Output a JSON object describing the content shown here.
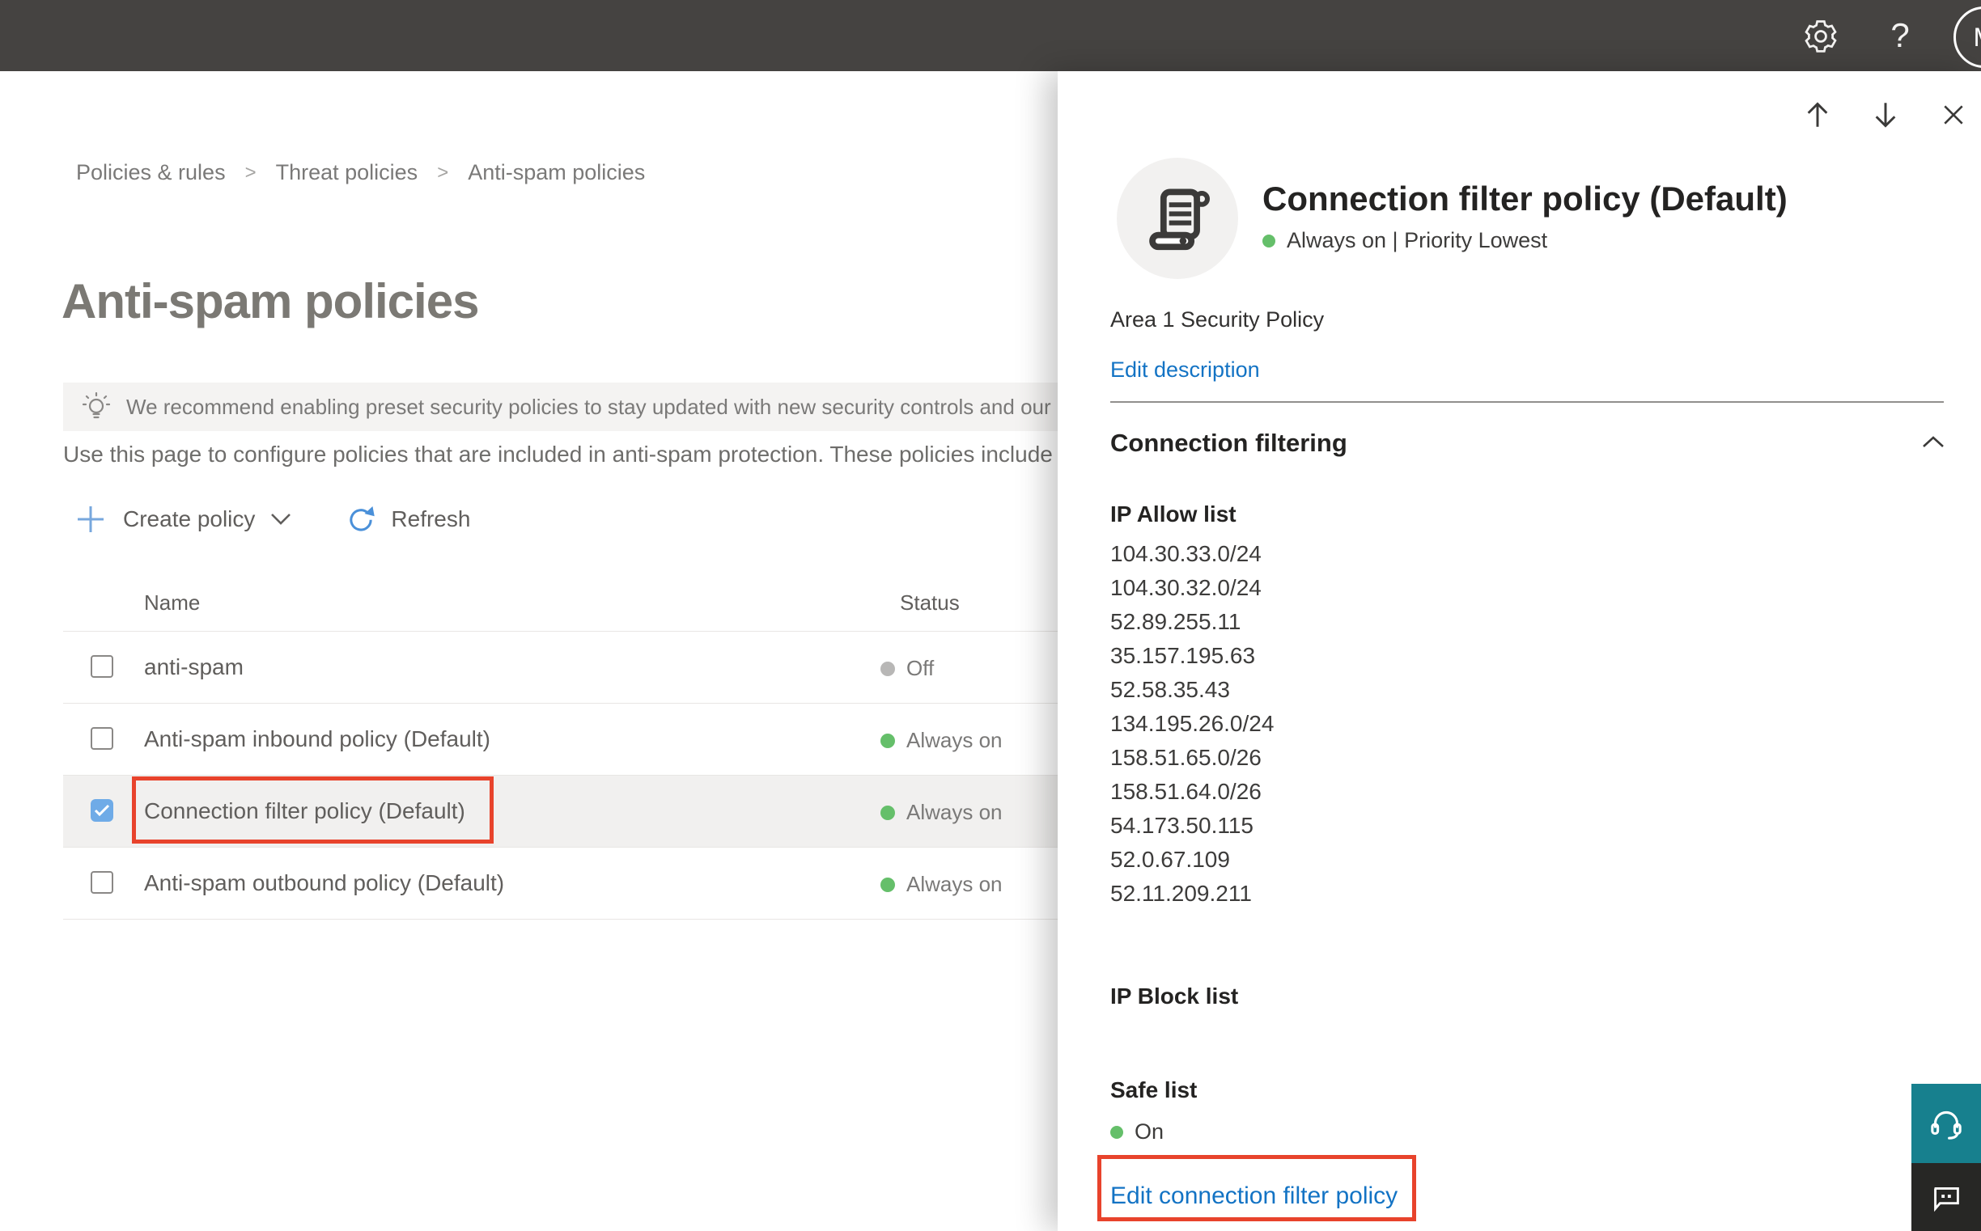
{
  "topbar": {
    "avatar_initial": "M"
  },
  "breadcrumb": {
    "separator": ">",
    "items": [
      "Policies & rules",
      "Threat policies",
      "Anti-spam policies"
    ]
  },
  "page": {
    "title": "Anti-spam policies",
    "banner_text": "We recommend enabling preset security policies to stay updated with new security controls and our recomme",
    "description": "Use this page to configure policies that are included in anti-spam protection. These policies include"
  },
  "toolbar": {
    "create_label": "Create policy",
    "refresh_label": "Refresh"
  },
  "table": {
    "headers": {
      "name": "Name",
      "status": "Status"
    },
    "rows": [
      {
        "name": "anti-spam",
        "status": "Off",
        "status_color": "#b8b7b6",
        "checked": false,
        "selected": false
      },
      {
        "name": "Anti-spam inbound policy (Default)",
        "status": "Always on",
        "status_color": "#65bf6a",
        "checked": false,
        "selected": false
      },
      {
        "name": "Connection filter policy (Default)",
        "status": "Always on",
        "status_color": "#65bf6a",
        "checked": true,
        "selected": true,
        "annotated": true
      },
      {
        "name": "Anti-spam outbound policy (Default)",
        "status": "Always on",
        "status_color": "#65bf6a",
        "checked": false,
        "selected": false
      }
    ]
  },
  "flyout": {
    "title": "Connection filter policy (Default)",
    "status_line": "Always on | Priority Lowest",
    "description": "Area 1 Security Policy",
    "edit_description_label": "Edit description",
    "section_title": "Connection filtering",
    "ip_allow_label": "IP Allow list",
    "ip_allow": [
      "104.30.33.0/24",
      "104.30.32.0/24",
      "52.89.255.11",
      "35.157.195.63",
      "52.58.35.43",
      "134.195.26.0/24",
      "158.51.65.0/26",
      "158.51.64.0/26",
      "54.173.50.115",
      "52.0.67.109",
      "52.11.209.211"
    ],
    "ip_block_label": "IP Block list",
    "safe_list_label": "Safe list",
    "safe_list_status": "On",
    "edit_link_label": "Edit connection filter policy"
  },
  "colors": {
    "topbar_gray": "#454341",
    "link_blue": "#1373c4",
    "status_green": "#65bf6a",
    "status_gray": "#b8b7b6",
    "checkbox_blue": "#6fabe7",
    "annotation_red": "#e8432c",
    "support_teal": "#17808e",
    "selected_row_bg": "#f1f0ef"
  }
}
